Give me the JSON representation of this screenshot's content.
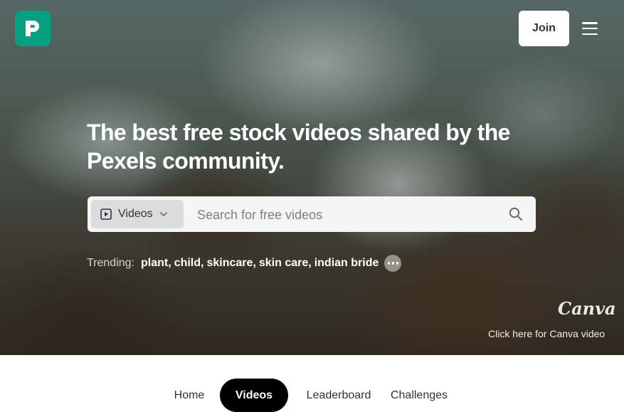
{
  "header": {
    "logo_icon": "pexels-logo-icon",
    "join_label": "Join",
    "menu_icon": "hamburger-menu-icon"
  },
  "hero": {
    "headline": "The best free stock videos shared by the Pexels community.",
    "search": {
      "media_type": "Videos",
      "placeholder": "Search for free videos",
      "search_icon": "search-icon"
    },
    "trending": {
      "label": "Trending:",
      "terms": [
        "plant",
        "child",
        "skincare",
        "skin care",
        "indian bride"
      ],
      "more_icon": "more-dots-icon"
    },
    "canva_brand": "Canva",
    "canva_link": "Click here for Canva video"
  },
  "tabs": [
    {
      "label": "Home",
      "active": false
    },
    {
      "label": "Videos",
      "active": true
    },
    {
      "label": "Leaderboard",
      "active": false
    },
    {
      "label": "Challenges",
      "active": false
    }
  ],
  "colors": {
    "brand": "#05a081",
    "tab_active_bg": "#000000"
  }
}
